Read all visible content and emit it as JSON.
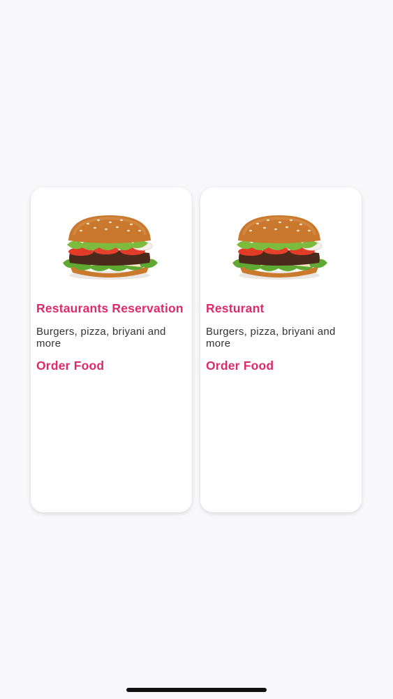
{
  "cards": [
    {
      "title": "Restaurants Reservation",
      "description": "Burgers, pizza, briyani and more",
      "action_label": "Order Food",
      "image_icon": "burger-image"
    },
    {
      "title": "Resturant",
      "description": "Burgers, pizza, briyani and more",
      "action_label": "Order Food",
      "image_icon": "burger-image"
    }
  ],
  "colors": {
    "accent": "#df2a68",
    "background": "#f8f7fa",
    "card_background": "#ffffff",
    "text": "#333333"
  }
}
